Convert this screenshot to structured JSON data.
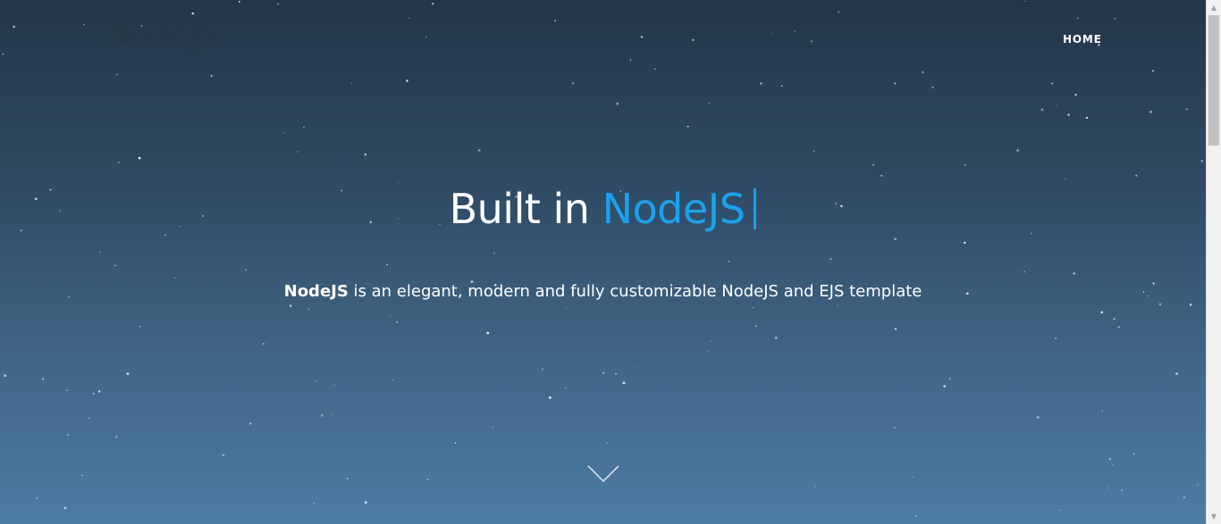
{
  "brand": {
    "logo_text": "NodeJS"
  },
  "nav": {
    "home_label": "HOME"
  },
  "hero": {
    "headline_prefix": "Built in",
    "headline_accent": "NodeJS",
    "subline_strong": "NodeJS",
    "subline_rest": " is an elegant, modern and fully customizable NodeJS and EJS template"
  },
  "icons": {
    "scroll_down": "chevron-down-icon",
    "scroll_up_arrow": "▲",
    "scroll_down_arrow": "▼"
  },
  "colors": {
    "accent": "#18a2ee",
    "bg_top": "#243649",
    "bg_bottom": "#4d7ca3",
    "text": "#ffffff"
  }
}
